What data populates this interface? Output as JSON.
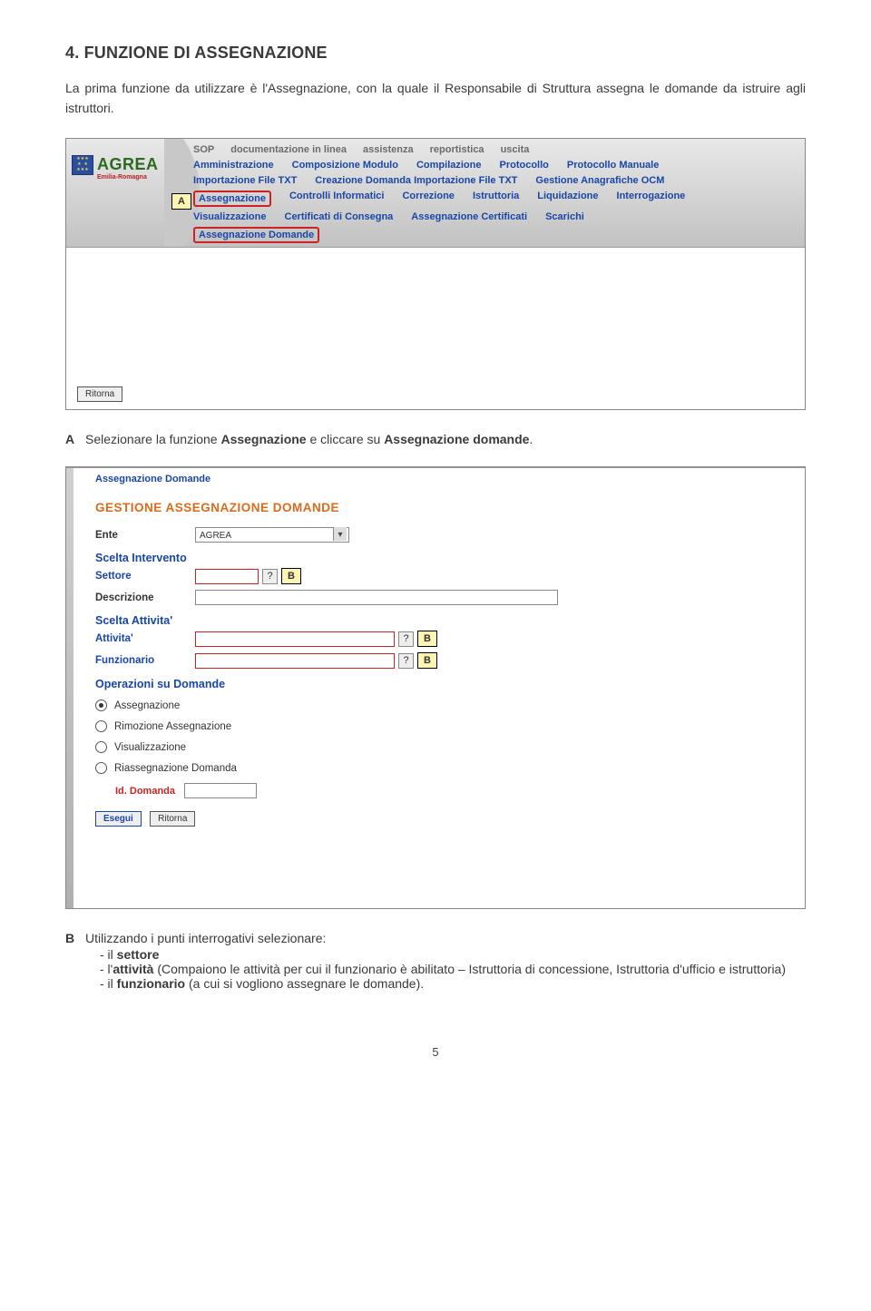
{
  "heading": "4. FUNZIONE DI ASSEGNAZIONE",
  "intro_part1": "La prima funzione da utilizzare è l'Assegnazione, con la quale il Responsabile di Struttura assegna le domande da istruire agli istruttori.",
  "shot1": {
    "top_menu": [
      "SOP",
      "documentazione in linea",
      "assistenza",
      "reportistica",
      "uscita"
    ],
    "menu_rows": [
      [
        "Amministrazione",
        "Composizione Modulo",
        "Compilazione",
        "Protocollo",
        "Protocollo Manuale"
      ],
      [
        "Importazione File TXT",
        "Creazione Domanda Importazione File TXT",
        "Gestione Anagrafiche OCM"
      ],
      [
        "Assegnazione",
        "Controlli Informatici",
        "Correzione",
        "Istruttoria",
        "Liquidazione",
        "Interrogazione"
      ],
      [
        "Visualizzazione",
        "Certificati di Consegna",
        "Assegnazione Certificati",
        "Scarichi"
      ],
      [
        "Assegnazione Domande"
      ]
    ],
    "callout_A": "A",
    "logo": {
      "brand": "AGREA",
      "sub": "Emilia-Romagna"
    },
    "ritorna": "Ritorna"
  },
  "captionA": {
    "letter": "A",
    "prefix": "Selezionare la funzione ",
    "bold1": "Assegnazione",
    "mid": " e cliccare su ",
    "bold2": "Assegnazione domande",
    "suffix": "."
  },
  "shot2": {
    "breadcrumb": "Assegnazione Domande",
    "title": "GESTIONE ASSEGNAZIONE DOMANDE",
    "ente_label": "Ente",
    "ente_value": "AGREA",
    "scelta_intervento": "Scelta Intervento",
    "settore_label": "Settore",
    "descrizione_label": "Descrizione",
    "scelta_attivita": "Scelta Attivita'",
    "attivita_label": "Attivita'",
    "funzionario_label": "Funzionario",
    "operazioni": "Operazioni su Domande",
    "radios": [
      {
        "label": "Assegnazione",
        "checked": true
      },
      {
        "label": "Rimozione Assegnazione",
        "checked": false
      },
      {
        "label": "Visualizzazione",
        "checked": false
      },
      {
        "label": "Riassegnazione Domanda",
        "checked": false
      }
    ],
    "id_domanda": "Id. Domanda",
    "esegui": "Esegui",
    "ritorna": "Ritorna",
    "B": "B",
    "help": "?"
  },
  "captionB": {
    "letter": "B",
    "lead": "Utilizzando i punti interrogativi selezionare:",
    "li1_prefix": "- il ",
    "li1_bold": "settore",
    "li2_prefix": "- l'",
    "li2_bold": "attività",
    "li2_rest": " (Compaiono le attività per cui il funzionario è abilitato – Istruttoria di concessione, Istruttoria d'ufficio e istruttoria)",
    "li3_prefix": "- il ",
    "li3_bold": "funzionario",
    "li3_rest": " (a cui si vogliono assegnare le domande)."
  },
  "page_number": "5"
}
